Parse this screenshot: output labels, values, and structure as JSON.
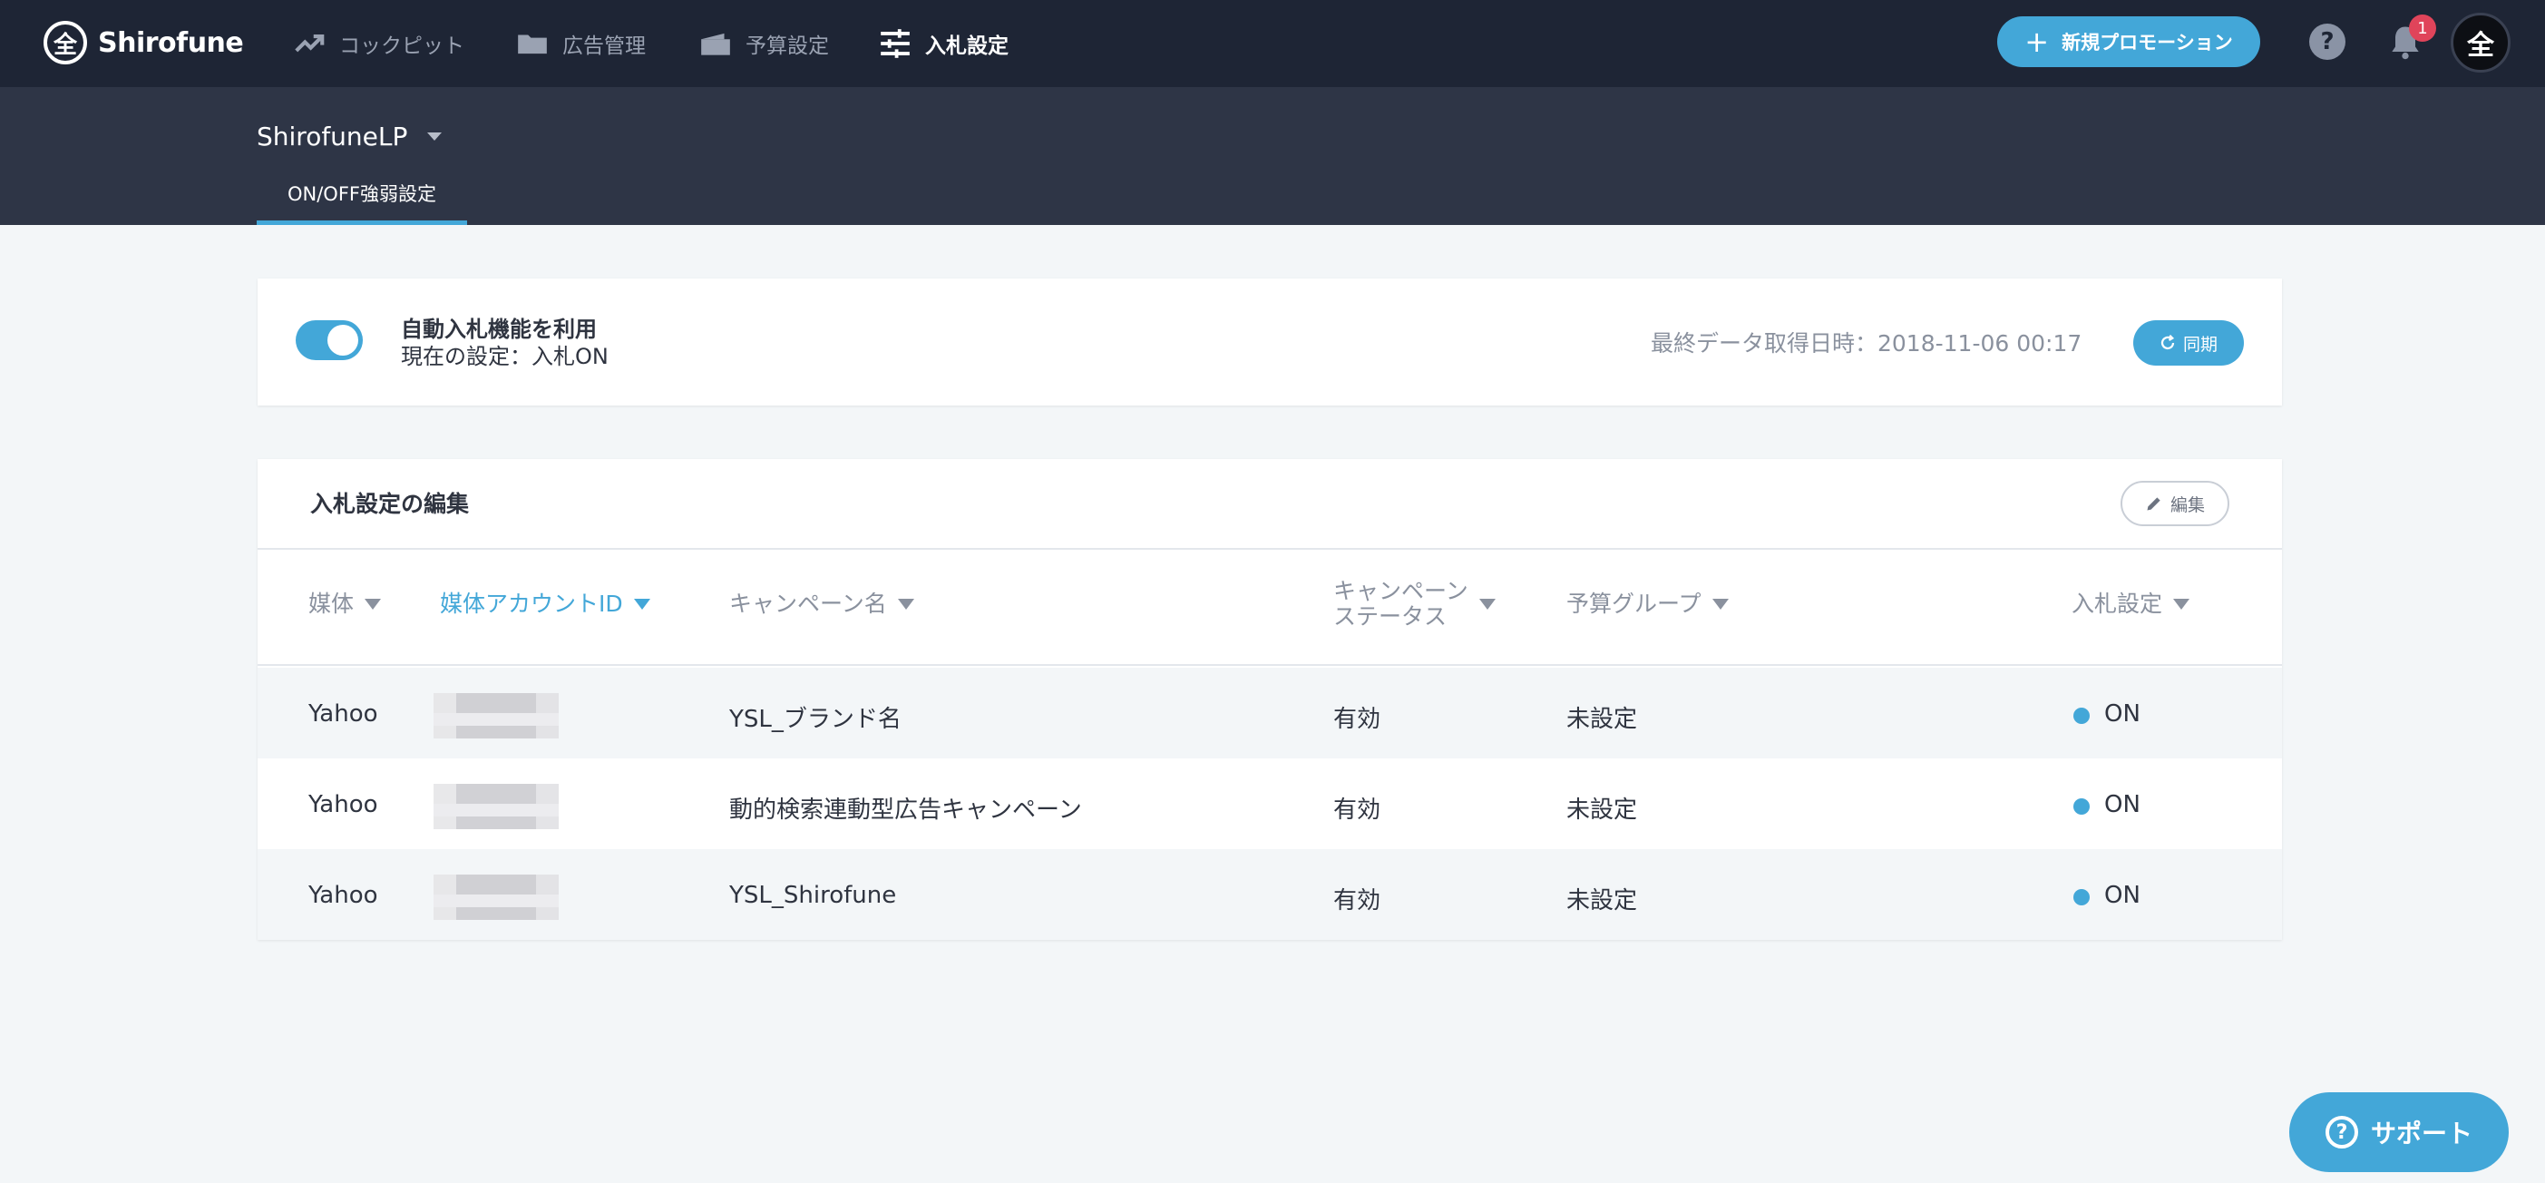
{
  "brand": {
    "name": "Shirofune",
    "mark": "全"
  },
  "nav": [
    {
      "label": "コックピット",
      "icon": "trend-icon"
    },
    {
      "label": "広告管理",
      "icon": "folder-icon"
    },
    {
      "label": "予算設定",
      "icon": "wallet-icon"
    },
    {
      "label": "入札設定",
      "icon": "sliders-icon",
      "active": true
    }
  ],
  "header": {
    "promo_label": "新規プロモーション",
    "help_label": "?",
    "notification_count": "1",
    "avatar_mark": "全"
  },
  "account": {
    "name": "ShirofuneLP"
  },
  "subtab": {
    "label": "ON/OFF強弱設定"
  },
  "auto_bid": {
    "title": "自動入札機能を利用",
    "current": "現在の設定：入札ON",
    "enabled": true,
    "last_fetch": "最終データ取得日時：2018-11-06 00:17",
    "sync_label": "同期"
  },
  "edit_section": {
    "title": "入札設定の編集",
    "edit_label": "編集"
  },
  "table": {
    "columns": [
      "媒体",
      "媒体アカウントID",
      "キャンペーン名",
      "キャンペーン\nステータス",
      "予算グループ",
      "入札設定"
    ],
    "rows": [
      {
        "media": "Yahoo",
        "campaign": "YSL_ブランド名",
        "status": "有効",
        "budget_group": "未設定",
        "bid": "ON"
      },
      {
        "media": "Yahoo",
        "campaign": "動的検索連動型広告キャンペーン",
        "status": "有効",
        "budget_group": "未設定",
        "bid": "ON"
      },
      {
        "media": "Yahoo",
        "campaign": "YSL_Shirofune",
        "status": "有効",
        "budget_group": "未設定",
        "bid": "ON"
      }
    ]
  },
  "support": {
    "label": "サポート"
  },
  "colors": {
    "accent": "#43a7d8",
    "nav_bg": "#1e2535",
    "sub_bg": "#2e3546",
    "badge": "#e0445a"
  }
}
